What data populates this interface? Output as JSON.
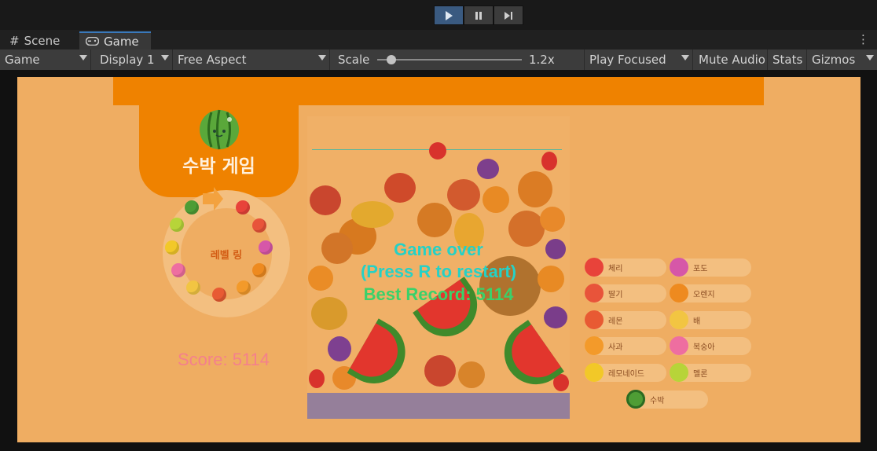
{
  "toolbar": {
    "play_icon": "play-icon",
    "pause_icon": "pause-icon",
    "step_icon": "step-icon"
  },
  "tabs": [
    {
      "label": "Scene",
      "icon": "hash-icon"
    },
    {
      "label": "Game",
      "icon": "gamepad-icon"
    }
  ],
  "gamebar": {
    "view": "Game",
    "display": "Display 1",
    "aspect": "Free Aspect",
    "scale_label": "Scale",
    "scale_value": "1.2x",
    "scale_fraction": 0.1,
    "play_mode": "Play Focused",
    "mute": "Mute Audio",
    "stats": "Stats",
    "gizmos": "Gizmos"
  },
  "game": {
    "title": "수박 게임",
    "ring_label": "레벨 링",
    "score": "Score: 5114",
    "game_over": "Game over",
    "restart_hint": "(Press R to restart)",
    "best_record": "Best Record: 5114",
    "legend": [
      {
        "label": "체리",
        "color": "#e8433a"
      },
      {
        "label": "포도",
        "color": "#d657a8"
      },
      {
        "label": "딸기",
        "color": "#e8543a"
      },
      {
        "label": "오렌지",
        "color": "#ee8a1f"
      },
      {
        "label": "레몬",
        "color": "#e85a33"
      },
      {
        "label": "배",
        "color": "#f2c542"
      },
      {
        "label": "사과",
        "color": "#f39a2a"
      },
      {
        "label": "복숭아",
        "color": "#ee6ea0"
      },
      {
        "label": "레모네이드",
        "color": "#f2c828"
      },
      {
        "label": "멜론",
        "color": "#b7d439"
      },
      {
        "label": "수박",
        "color": "#4e9d35"
      }
    ],
    "colors": {
      "background": "#efad62",
      "accent": "#ef8200",
      "game_over": "#25d1c6",
      "best": "#3ad16a",
      "score": "#f4808c"
    }
  }
}
